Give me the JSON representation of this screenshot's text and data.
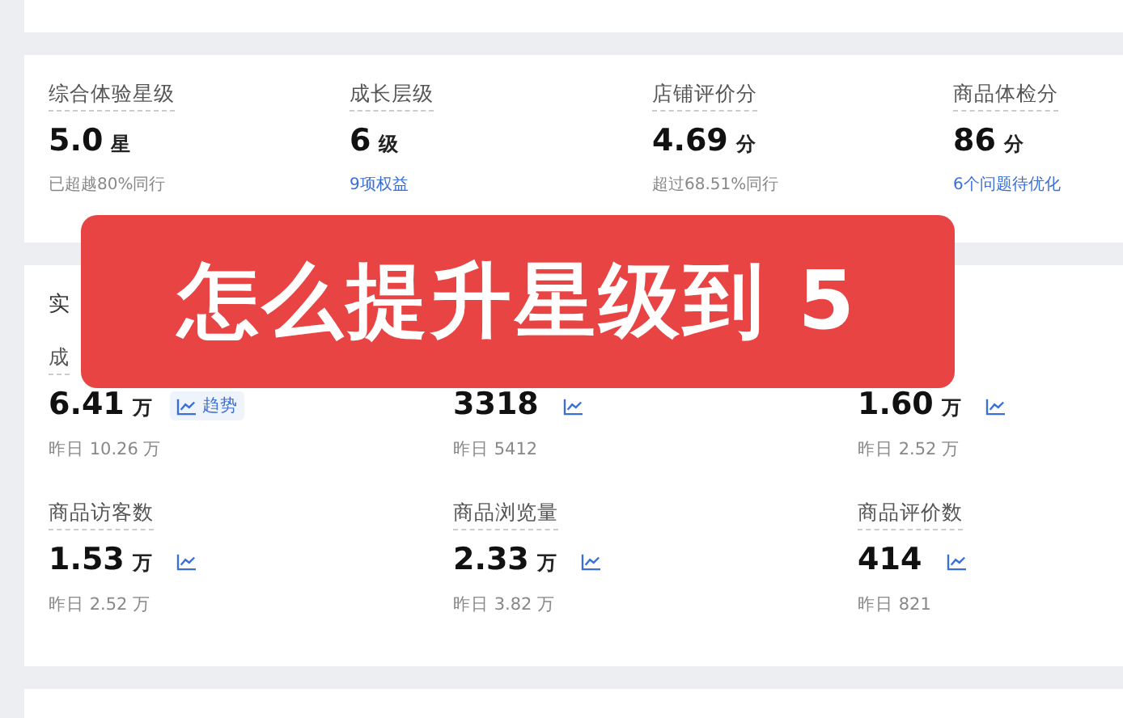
{
  "overview": {
    "stats": [
      {
        "label": "综合体验星级",
        "value": "5.0",
        "unit": "星",
        "note": {
          "text": "已超越80%同行",
          "kind": "text"
        }
      },
      {
        "label": "成长层级",
        "value": "6",
        "unit": "级",
        "note": {
          "text": "9项权益",
          "kind": "link"
        }
      },
      {
        "label": "店铺评价分",
        "value": "4.69",
        "unit": "分",
        "note": {
          "text": "超过68.51%同行",
          "kind": "text"
        }
      },
      {
        "label": "商品体检分",
        "value": "86",
        "unit": "分",
        "note": {
          "text": "6个问题待优化",
          "kind": "link"
        }
      }
    ]
  },
  "realtime": {
    "title": "实",
    "metrics": [
      {
        "label": "成",
        "value": "6.41",
        "unit": "万",
        "trend_label": "趋势",
        "yesterday": "昨日 10.26 万"
      },
      {
        "value": "3318",
        "yesterday": "昨日 5412"
      },
      {
        "value": "1.60",
        "unit": "万",
        "yesterday": "昨日 2.52 万"
      },
      {
        "label": "商品访客数",
        "value": "1.53",
        "unit": "万",
        "yesterday": "昨日 2.52 万"
      },
      {
        "label": "商品浏览量",
        "value": "2.33",
        "unit": "万",
        "yesterday": "昨日 3.82 万"
      },
      {
        "label": "商品评价数",
        "value": "414",
        "yesterday": "昨日 821"
      }
    ]
  },
  "banner": {
    "text": "怎么提升星级到 5"
  }
}
